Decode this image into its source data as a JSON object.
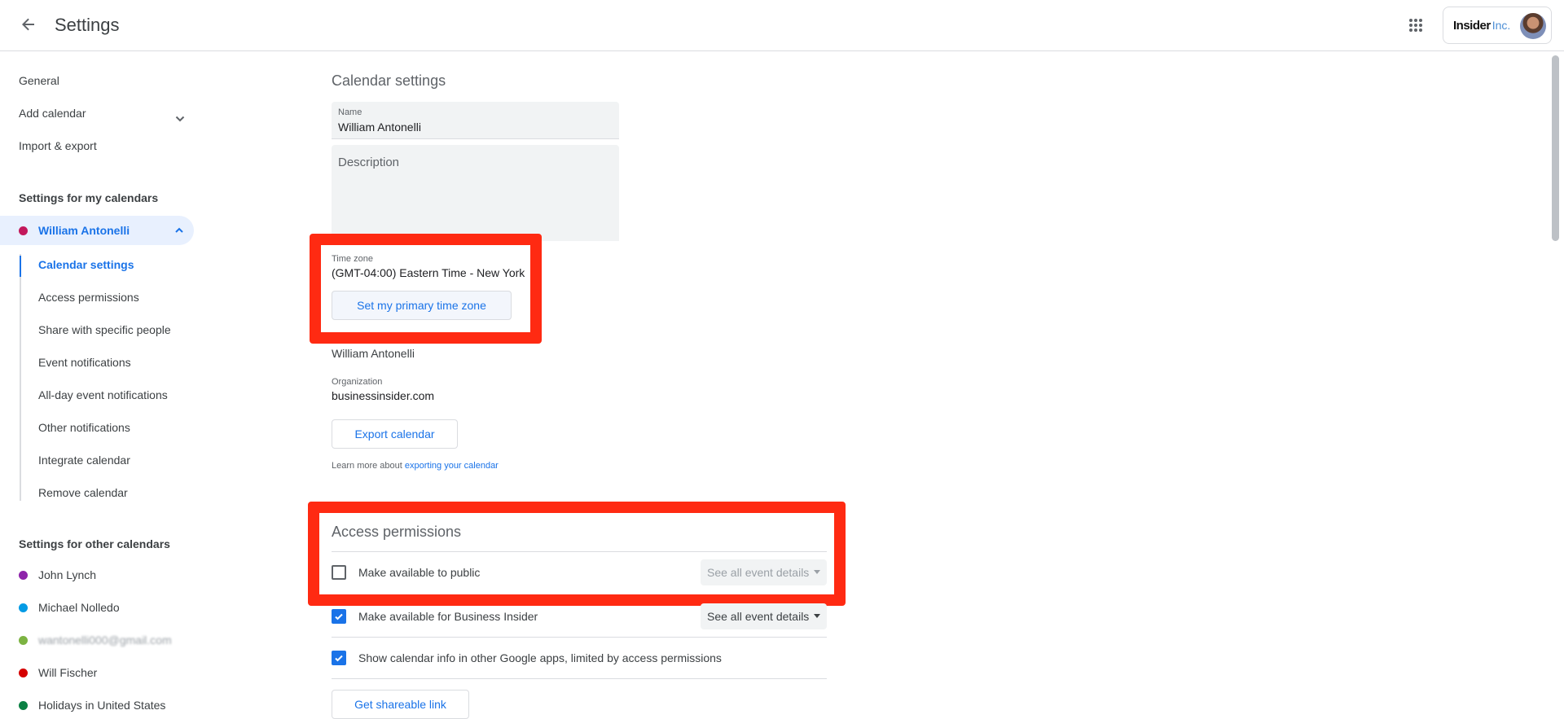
{
  "header": {
    "title": "Settings",
    "brand_name": "Insider",
    "brand_suffix": "Inc."
  },
  "sidebar": {
    "general": "General",
    "add_calendar": "Add calendar",
    "import_export": "Import & export",
    "my_calendars_heading": "Settings for my calendars",
    "active_calendar": {
      "label": "William Antonelli",
      "color": "#c2185b"
    },
    "sub_items": [
      "Calendar settings",
      "Access permissions",
      "Share with specific people",
      "Event notifications",
      "All-day event notifications",
      "Other notifications",
      "Integrate calendar",
      "Remove calendar"
    ],
    "other_calendars_heading": "Settings for other calendars",
    "other_calendars": [
      {
        "label": "John Lynch",
        "color": "#8e24aa"
      },
      {
        "label": "Michael Nolledo",
        "color": "#039be5"
      },
      {
        "label": "wantonelli000@gmail.com",
        "color": "#7cb342"
      },
      {
        "label": "Will Fischer",
        "color": "#d50000"
      },
      {
        "label": "Holidays in United States",
        "color": "#0b8043"
      }
    ]
  },
  "main": {
    "section_title": "Calendar settings",
    "name_label": "Name",
    "name_value": "William Antonelli",
    "description_placeholder": "Description",
    "timezone_label": "Time zone",
    "timezone_value": "(GMT-04:00) Eastern Time - New York",
    "timezone_button": "Set my primary time zone",
    "owner_name": "William Antonelli",
    "organization_label": "Organization",
    "organization_value": "businessinsider.com",
    "export_button": "Export calendar",
    "learn_more_prefix": "Learn more about ",
    "learn_more_link": "exporting your calendar",
    "access_permissions_title": "Access permissions",
    "permissions": [
      {
        "label": "Make available to public",
        "checked": false,
        "select": "See all event details",
        "select_enabled": false
      },
      {
        "label": "Make available for Business Insider",
        "checked": true,
        "select": "See all event details",
        "select_enabled": true
      },
      {
        "label": "Show calendar info in other Google apps, limited by access permissions",
        "checked": true
      }
    ],
    "shareable_link_button": "Get shareable link"
  },
  "colors": {
    "accent": "#1a73e8",
    "highlight_box": "#ff2a12"
  }
}
